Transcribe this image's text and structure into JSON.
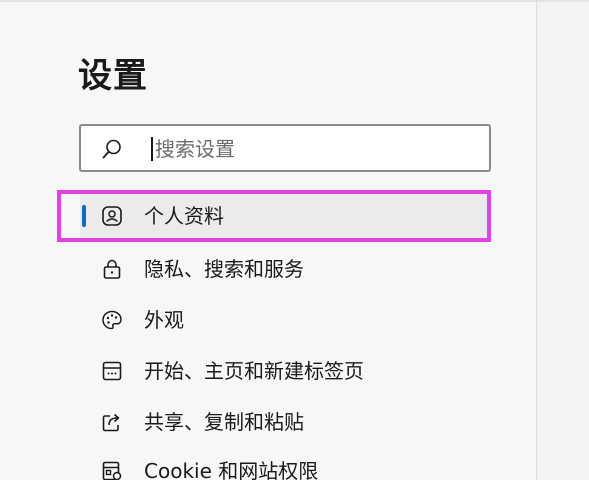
{
  "settings": {
    "title": "设置",
    "search": {
      "placeholder": "搜索设置",
      "value": ""
    },
    "nav_items": [
      {
        "label": "个人资料",
        "icon": "profile-icon",
        "active": true
      },
      {
        "label": "隐私、搜索和服务",
        "icon": "lock-icon",
        "active": false
      },
      {
        "label": "外观",
        "icon": "palette-icon",
        "active": false
      },
      {
        "label": "开始、主页和新建标签页",
        "icon": "start-home-icon",
        "active": false
      },
      {
        "label": "共享、复制和粘贴",
        "icon": "share-icon",
        "active": false
      },
      {
        "label": "Cookie 和网站权限",
        "icon": "site-permissions-icon",
        "active": false
      }
    ]
  },
  "colors": {
    "accent": "#0f6cbd",
    "highlight_frame": "#e53fe3",
    "background": "#f7f7f7"
  }
}
